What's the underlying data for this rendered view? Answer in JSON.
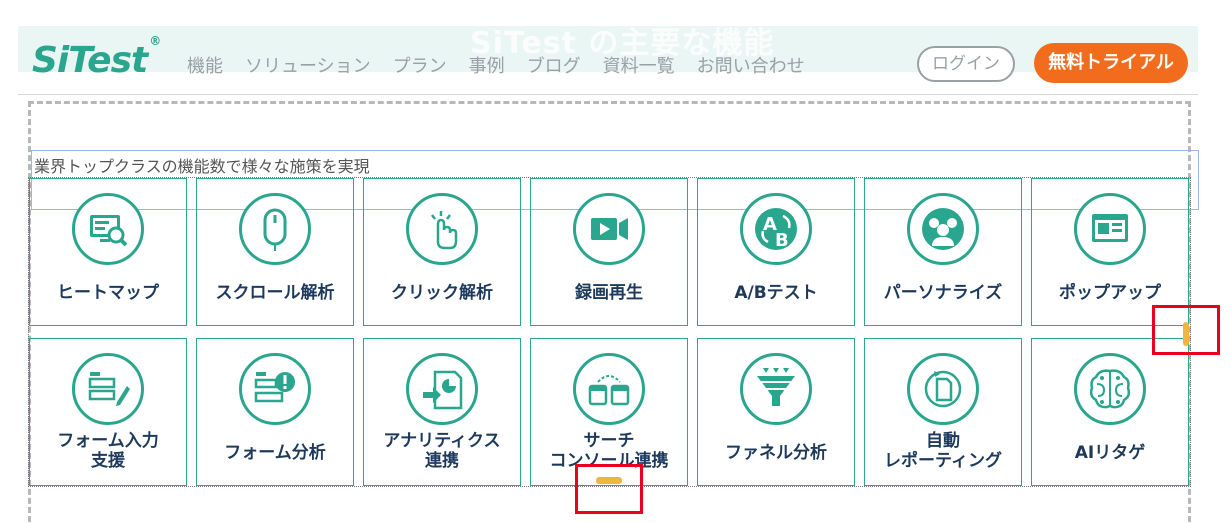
{
  "header": {
    "ghost_title": "SiTest の主要な機能",
    "logo": "SiTest",
    "logo_mark": "®",
    "nav": [
      "機能",
      "ソリューション",
      "プラン",
      "事例",
      "ブログ",
      "資料一覧",
      "お問い合わせ"
    ],
    "login": "ログイン",
    "trial": "無料トライアル"
  },
  "subtitle": "業界トップクラスの機能数で様々な施策を実現",
  "features": [
    {
      "label": "ヒートマップ",
      "icon": "heatmap-icon"
    },
    {
      "label": "スクロール解析",
      "icon": "mouse-icon"
    },
    {
      "label": "クリック解析",
      "icon": "click-hand-icon"
    },
    {
      "label": "録画再生",
      "icon": "video-camera-icon"
    },
    {
      "label": "A/Bテスト",
      "icon": "ab-test-icon"
    },
    {
      "label": "パーソナライズ",
      "icon": "people-group-icon"
    },
    {
      "label": "ポップアップ",
      "icon": "popup-window-icon"
    },
    {
      "label": "フォーム入力\n支援",
      "icon": "form-edit-icon"
    },
    {
      "label": "フォーム分析",
      "icon": "form-alert-icon"
    },
    {
      "label": "アナリティクス\n連携",
      "icon": "analytics-link-icon"
    },
    {
      "label": "サーチ\nコンソール連携",
      "icon": "search-console-icon"
    },
    {
      "label": "ファネル分析",
      "icon": "funnel-icon"
    },
    {
      "label": "自動\nレポーティング",
      "icon": "auto-report-icon"
    },
    {
      "label": "AIリタゲ",
      "icon": "ai-brain-icon"
    }
  ],
  "colors": {
    "accent": "#2aa58e",
    "label": "#1d3a5c",
    "trial": "#f26c1d",
    "highlight": "#e8001c",
    "handle": "#f0b440"
  }
}
